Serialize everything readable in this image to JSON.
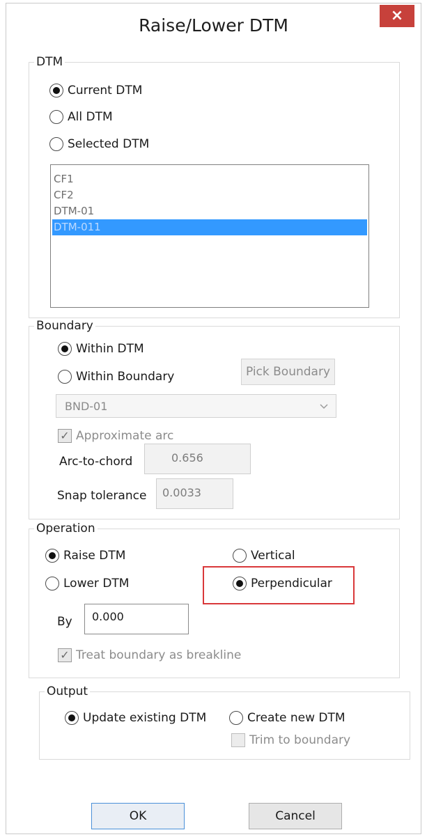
{
  "window": {
    "title": "Raise/Lower DTM",
    "close_glyph": "×"
  },
  "dtm": {
    "group_label": "DTM",
    "options": [
      {
        "label": "Current DTM",
        "selected": true
      },
      {
        "label": "All DTM",
        "selected": false
      },
      {
        "label": "Selected DTM",
        "selected": false
      }
    ],
    "list": [
      "CF1",
      "CF2",
      "DTM-01",
      "DTM-011"
    ],
    "list_selected_index": 3
  },
  "boundary": {
    "group_label": "Boundary",
    "within_dtm": "Within DTM",
    "within_boundary": "Within Boundary",
    "pick_boundary": "Pick Boundary",
    "boundary_value": "BND-01",
    "approximate_arc": "Approximate arc",
    "arc_to_chord_label": "Arc-to-chord",
    "arc_to_chord_value": "0.656",
    "snap_tolerance_label": "Snap tolerance",
    "snap_tolerance_value": "0.0033"
  },
  "operation": {
    "group_label": "Operation",
    "raise": "Raise DTM",
    "lower": "Lower DTM",
    "vertical": "Vertical",
    "perpendicular": "Perpendicular",
    "by_label": "By",
    "by_value": "0.000",
    "treat_boundary": "Treat boundary as breakline"
  },
  "output": {
    "group_label": "Output",
    "update_existing": "Update existing DTM",
    "create_new": "Create new DTM",
    "trim": "Trim to boundary"
  },
  "buttons": {
    "ok": "OK",
    "cancel": "Cancel"
  },
  "colors": {
    "close": "#c7413b",
    "selection": "#3399ff",
    "highlight": "#d9383a"
  },
  "icons": {
    "chevron": "chevron-down-icon",
    "check": "checkmark-icon"
  }
}
